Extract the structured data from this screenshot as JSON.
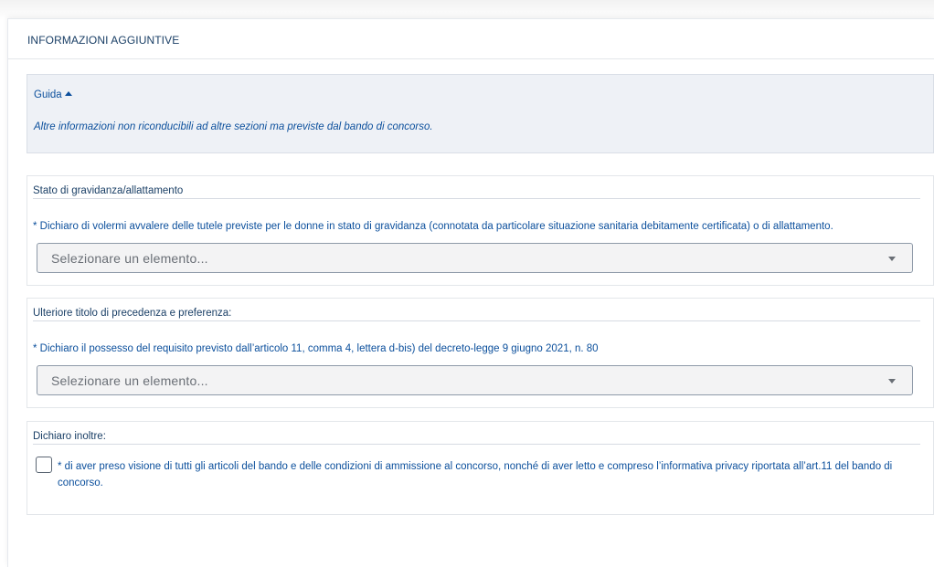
{
  "card": {
    "title": "INFORMAZIONI AGGIUNTIVE"
  },
  "guide": {
    "toggle_label": "Guida",
    "text": "Altre informazioni non riconducibili ad altre sezioni ma previste dal bando di concorso."
  },
  "sections": [
    {
      "title": "Stato di gravidanza/allattamento",
      "question": "* Dichiaro di volermi avvalere delle tutele previste per le donne in stato di gravidanza (connotata da particolare situazione sanitaria debitamente certificata) o di allattamento.",
      "select_placeholder": "Selezionare un elemento..."
    },
    {
      "title": "Ulteriore titolo di precedenza e preferenza:",
      "question": "* Dichiaro il possesso del requisito previsto dall’articolo 11, comma 4, lettera d-bis) del decreto-legge 9 giugno 2021, n. 80",
      "select_placeholder": "Selezionare un elemento..."
    },
    {
      "title": "Dichiaro inoltre:",
      "checkbox_label": "* di aver preso visione di tutti gli articoli del bando e delle condizioni di ammissione al concorso, nonché di aver letto e compreso l’informativa privacy riportata all’art.11 del bando di concorso.",
      "checked": false
    }
  ]
}
